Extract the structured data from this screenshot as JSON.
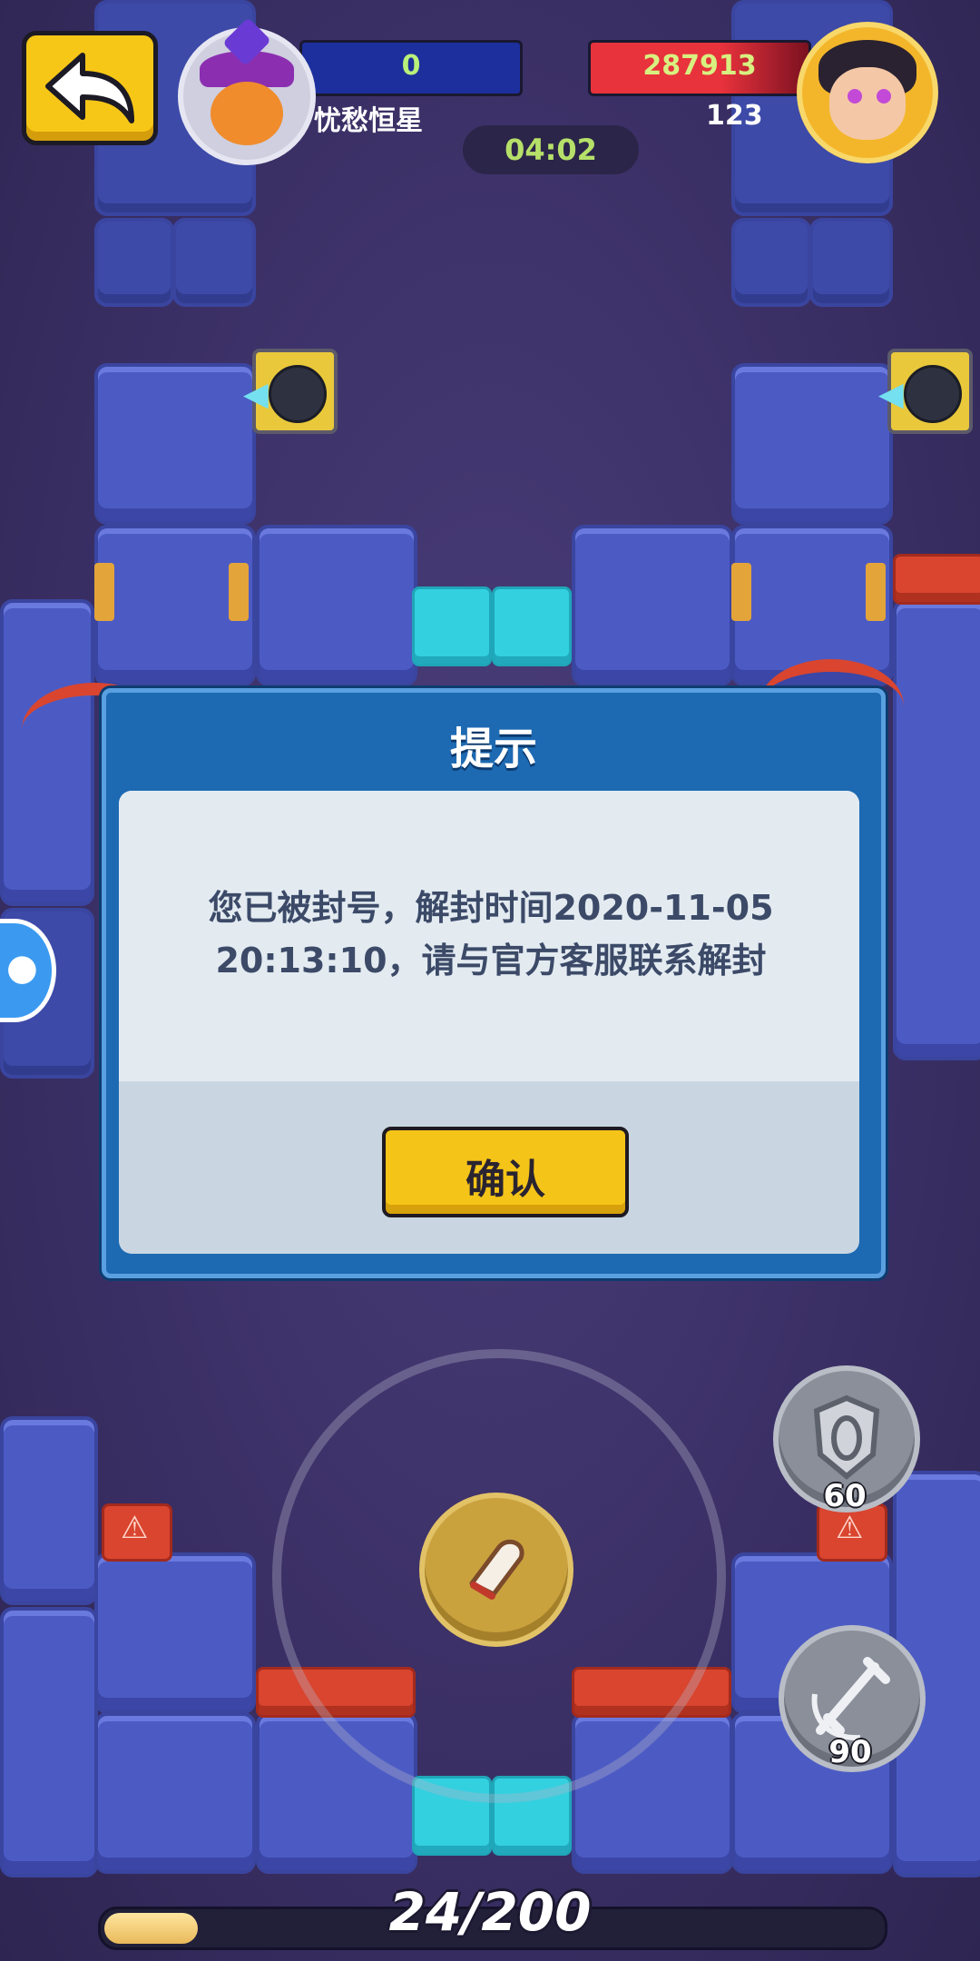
{
  "hud": {
    "player1": {
      "name": "忧愁恒星",
      "score": "0"
    },
    "player2": {
      "name": "123",
      "score": "287913"
    },
    "timer": "04:02"
  },
  "dialog": {
    "title": "提示",
    "message": "您已被封号，解封时间2020-11-05 20:13:10，请与官方客服联系解封",
    "confirm_label": "确认"
  },
  "skills": [
    {
      "icon": "shield-skill-icon",
      "count": "60"
    },
    {
      "icon": "sword-skill-icon",
      "count": "90"
    }
  ],
  "progress": {
    "text": "24/200",
    "current": 24,
    "total": 200
  },
  "colors": {
    "accent_yellow": "#f5c418",
    "dialog_blue": "#1d6ab3",
    "timer_green": "#c4f36a"
  }
}
